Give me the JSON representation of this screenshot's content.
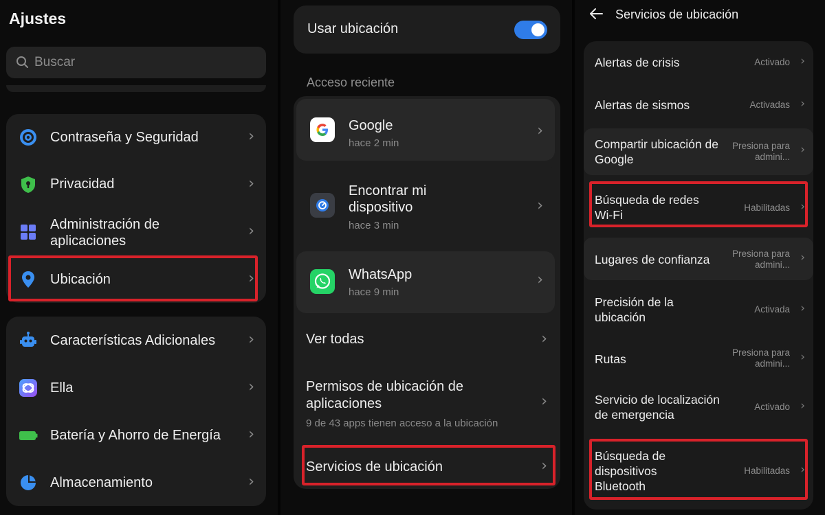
{
  "panel1": {
    "title": "Ajustes",
    "search_placeholder": "Buscar",
    "group1": [
      {
        "label": "Contraseña y Seguridad",
        "icon": "security-target-icon",
        "color": "#3a8ff0"
      },
      {
        "label": "Privacidad",
        "icon": "privacy-shield-icon",
        "color": "#3fbf4b"
      },
      {
        "label": "Administración de aplicaciones",
        "icon": "apps-grid-icon",
        "color": "#6b7cf6"
      },
      {
        "label": "Ubicación",
        "icon": "location-pin-icon",
        "color": "#3a8ff0"
      }
    ],
    "group2": [
      {
        "label": "Características Adicionales",
        "icon": "robot-icon",
        "color": "#3a8ff0"
      },
      {
        "label": "Ella",
        "icon": "ella-assistant-icon",
        "color": "#7a5cf0"
      },
      {
        "label": "Batería y Ahorro de Energía",
        "icon": "battery-icon",
        "color": "#3fbf4b"
      },
      {
        "label": "Almacenamiento",
        "icon": "storage-pie-icon",
        "color": "#3a8ff0"
      }
    ]
  },
  "panel2": {
    "toggle_label": "Usar ubicación",
    "toggle_on": true,
    "recent_label": "Acceso reciente",
    "recent_apps": [
      {
        "name": "Google",
        "time": "hace 2 min",
        "icon": "google-icon"
      },
      {
        "name": "Encontrar mi dispositivo",
        "time": "hace 3 min",
        "icon": "find-my-device-icon"
      },
      {
        "name": "WhatsApp",
        "time": "hace 9 min",
        "icon": "whatsapp-icon"
      }
    ],
    "see_all": "Ver todas",
    "permissions_title": "Permisos de ubicación de aplicaciones",
    "permissions_sub": "9 de 43 apps tienen acceso a la ubicación",
    "services": "Servicios de ubicación"
  },
  "panel3": {
    "title": "Servicios de ubicación",
    "rows": [
      {
        "label": "Alertas de crisis",
        "value": "Activado"
      },
      {
        "label": "Alertas de sismos",
        "value": "Activadas"
      },
      {
        "label": "Compartir ubicación de Google",
        "value": "Presiona para admini..."
      },
      {
        "label": "Búsqueda de redes Wi-Fi",
        "value": "Habilitadas"
      },
      {
        "label": "Lugares de confianza",
        "value": "Presiona para admini..."
      },
      {
        "label": "Precisión de la ubicación",
        "value": "Activada"
      },
      {
        "label": "Rutas",
        "value": "Presiona para admini..."
      },
      {
        "label": "Servicio de localización de emergencia",
        "value": "Activado"
      },
      {
        "label": "Búsqueda de dispositivos Bluetooth",
        "value": "Habilitadas"
      }
    ]
  },
  "colors": {
    "highlight": "#d8222a",
    "accent": "#2f7ce8",
    "card": "#1e1e1e",
    "background": "#0c0c0c"
  }
}
